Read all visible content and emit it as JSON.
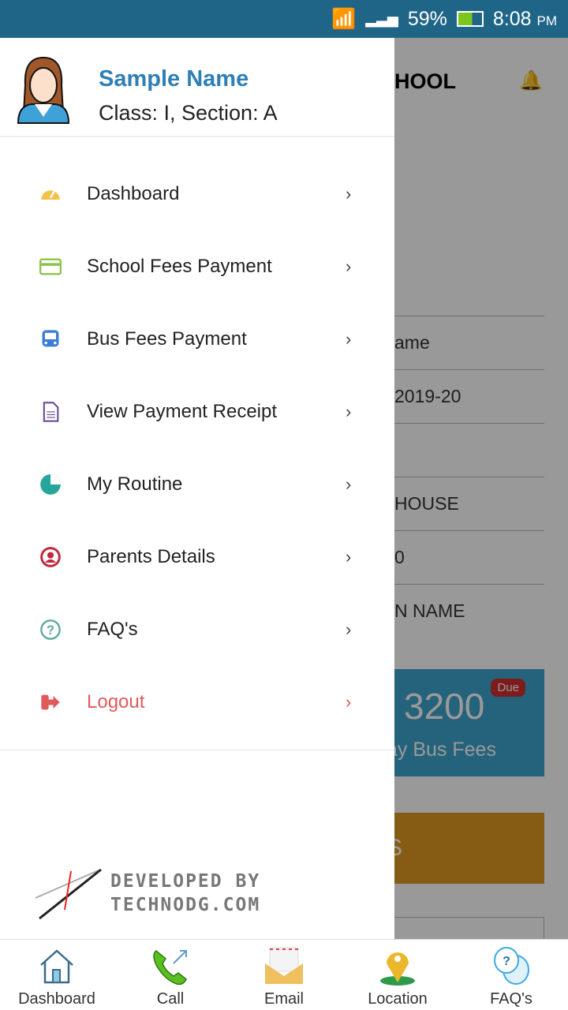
{
  "status_bar": {
    "battery": "59%",
    "time": "8:08",
    "ampm": "PM"
  },
  "background": {
    "title_fragment": "HOOL",
    "rows": [
      "ame",
      "2019-20",
      "",
      "HOUSE",
      "0",
      "N NAME"
    ],
    "bus_amount": "3200",
    "bus_label": "ay Bus Fees",
    "due_badge": "Due",
    "orange_fragment": "S"
  },
  "drawer": {
    "user_name": "Sample Name",
    "user_class": "Class: I, Section: A",
    "items": [
      {
        "label": "Dashboard",
        "icon": "speedometer-icon",
        "color": "#f2c347"
      },
      {
        "label": "School Fees Payment",
        "icon": "credit-card-icon",
        "color": "#8bc34a"
      },
      {
        "label": "Bus Fees Payment",
        "icon": "bus-icon",
        "color": "#3b7dd8"
      },
      {
        "label": "View Payment Receipt",
        "icon": "document-icon",
        "color": "#6a4c93"
      },
      {
        "label": "My Routine",
        "icon": "pie-chart-icon",
        "color": "#26a69a"
      },
      {
        "label": "Parents Details",
        "icon": "user-circle-icon",
        "color": "#c0283c"
      },
      {
        "label": "FAQ's",
        "icon": "question-circle-icon",
        "color": "#5fa8a0"
      },
      {
        "label": "Logout",
        "icon": "logout-icon",
        "color": "#e05a5a"
      }
    ],
    "chevron": "›",
    "developer_line1": "DEVELOPED BY",
    "developer_line2": "TECHNODG.COM"
  },
  "bottom_nav": [
    {
      "label": "Dashboard"
    },
    {
      "label": "Call"
    },
    {
      "label": "Email"
    },
    {
      "label": "Location"
    },
    {
      "label": "FAQ's"
    }
  ]
}
